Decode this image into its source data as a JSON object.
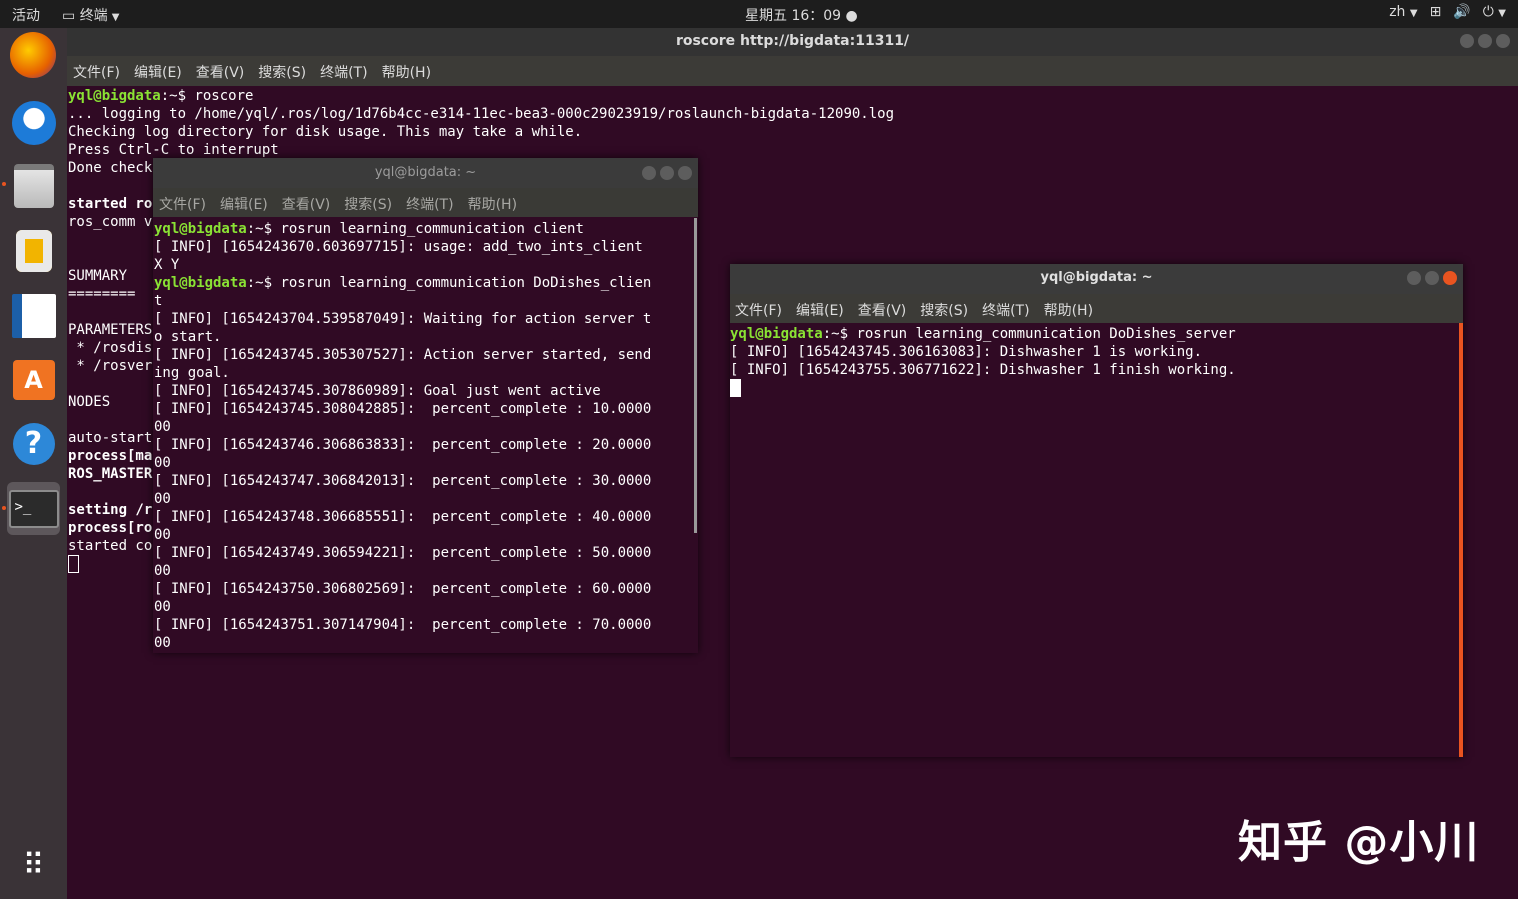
{
  "topbar": {
    "activities": "活动",
    "app_menu": "终端",
    "clock": "星期五 16：09",
    "lang": "zh"
  },
  "dock": {
    "apps": [
      "firefox-icon",
      "thunderbird-icon",
      "files-icon",
      "rhythmbox-icon",
      "writer-icon",
      "software-icon",
      "help-icon",
      "terminal-icon"
    ]
  },
  "main_window": {
    "title": "roscore http://bigdata:11311/",
    "menu": [
      "文件(F)",
      "编辑(E)",
      "查看(V)",
      "搜索(S)",
      "终端(T)",
      "帮助(H)"
    ],
    "lines": [
      {
        "prompt": "yql@bigdata",
        "path": ":~$ ",
        "text": "roscore"
      },
      {
        "text": "... logging to /home/yql/.ros/log/1d76b4cc-e314-11ec-bea3-000c29023919/roslaunch-bigdata-12090.log"
      },
      {
        "text": "Checking log directory for disk usage. This may take a while."
      },
      {
        "text": "Press Ctrl-C to interrupt"
      },
      {
        "text": "Done check"
      },
      {
        "text": ""
      },
      {
        "bold": "started ro"
      },
      {
        "text": "ros_comm v"
      },
      {
        "text": ""
      },
      {
        "text": ""
      },
      {
        "text": "SUMMARY"
      },
      {
        "text": "========"
      },
      {
        "text": ""
      },
      {
        "text": "PARAMETERS"
      },
      {
        "text": " * /rosdis"
      },
      {
        "text": " * /rosver"
      },
      {
        "text": ""
      },
      {
        "text": "NODES"
      },
      {
        "text": ""
      },
      {
        "text": "auto-start"
      },
      {
        "bold": "process[ma"
      },
      {
        "bold": "ROS_MASTER"
      },
      {
        "text": ""
      },
      {
        "bold": "setting /r"
      },
      {
        "bold": "process[ro"
      },
      {
        "text": "started co"
      }
    ]
  },
  "client_window": {
    "title": "yql@bigdata: ~",
    "menu": [
      "文件(F)",
      "编辑(E)",
      "查看(V)",
      "搜索(S)",
      "终端(T)",
      "帮助(H)"
    ],
    "lines": [
      {
        "prompt": "yql@bigdata",
        "path": ":~$ ",
        "text": "rosrun learning_communication client"
      },
      {
        "text": "[ INFO] [1654243670.603697715]: usage: add_two_ints_client"
      },
      {
        "text": "X Y"
      },
      {
        "prompt": "yql@bigdata",
        "path": ":~$ ",
        "text": "rosrun learning_communication DoDishes_clien"
      },
      {
        "text": "t"
      },
      {
        "text": "[ INFO] [1654243704.539587049]: Waiting for action server t"
      },
      {
        "text": "o start."
      },
      {
        "text": "[ INFO] [1654243745.305307527]: Action server started, send"
      },
      {
        "text": "ing goal."
      },
      {
        "text": "[ INFO] [1654243745.307860989]: Goal just went active"
      },
      {
        "text": "[ INFO] [1654243745.308042885]:  percent_complete : 10.0000"
      },
      {
        "text": "00"
      },
      {
        "text": "[ INFO] [1654243746.306863833]:  percent_complete : 20.0000"
      },
      {
        "text": "00"
      },
      {
        "text": "[ INFO] [1654243747.306842013]:  percent_complete : 30.0000"
      },
      {
        "text": "00"
      },
      {
        "text": "[ INFO] [1654243748.306685551]:  percent_complete : 40.0000"
      },
      {
        "text": "00"
      },
      {
        "text": "[ INFO] [1654243749.306594221]:  percent_complete : 50.0000"
      },
      {
        "text": "00"
      },
      {
        "text": "[ INFO] [1654243750.306802569]:  percent_complete : 60.0000"
      },
      {
        "text": "00"
      },
      {
        "text": "[ INFO] [1654243751.307147904]:  percent_complete : 70.0000"
      },
      {
        "text": "00"
      }
    ]
  },
  "server_window": {
    "title": "yql@bigdata: ~",
    "menu": [
      "文件(F)",
      "编辑(E)",
      "查看(V)",
      "搜索(S)",
      "终端(T)",
      "帮助(H)"
    ],
    "lines": [
      {
        "prompt": "yql@bigdata",
        "path": ":~$ ",
        "text": "rosrun learning_communication DoDishes_server"
      },
      {
        "text": "[ INFO] [1654243745.306163083]: Dishwasher 1 is working."
      },
      {
        "text": "[ INFO] [1654243755.306771622]: Dishwasher 1 finish working."
      }
    ]
  },
  "watermark": "知乎 @小川",
  "colors": {
    "terminal_bg": "#300a24",
    "prompt": "#8ae234",
    "path": "#729fcf",
    "accent": "#e95420"
  }
}
